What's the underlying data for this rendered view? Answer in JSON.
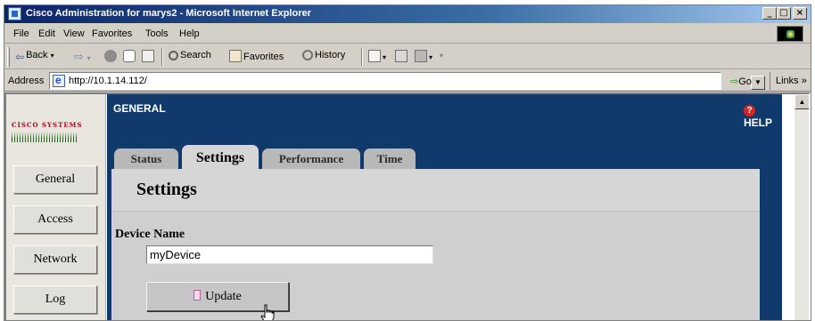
{
  "window": {
    "title": "Cisco Administration for marys2 - Microsoft Internet Explorer",
    "controls": {
      "minimize": "_",
      "maximize": "□",
      "close": "×"
    }
  },
  "menu": [
    "File",
    "Edit",
    "View",
    "Favorites",
    "Tools",
    "Help"
  ],
  "toolbar": {
    "back": "Back",
    "search": "Search",
    "favorites": "Favorites",
    "history": "History"
  },
  "address": {
    "label": "Address",
    "url": "http://10.1.14.112/",
    "go": "Go",
    "links": "Links »"
  },
  "sidebar": {
    "logo_text": "CISCO SYSTEMS",
    "items": [
      {
        "label": "General"
      },
      {
        "label": "Access"
      },
      {
        "label": "Network"
      },
      {
        "label": "Log"
      }
    ]
  },
  "main": {
    "section": "GENERAL",
    "help": "HELP",
    "tabs": [
      {
        "label": "Status"
      },
      {
        "label": "Settings"
      },
      {
        "label": "Performance"
      },
      {
        "label": "Time"
      }
    ],
    "active_tab": "Settings",
    "panel_title": "Settings",
    "device_name_label": "Device Name",
    "device_name_value": "myDevice",
    "update_label": "Update"
  },
  "colors": {
    "title_bar": "#0a246a",
    "main_background": "#103a6c",
    "panel": "#d6d6d6",
    "help_icon": "#dd2222"
  }
}
